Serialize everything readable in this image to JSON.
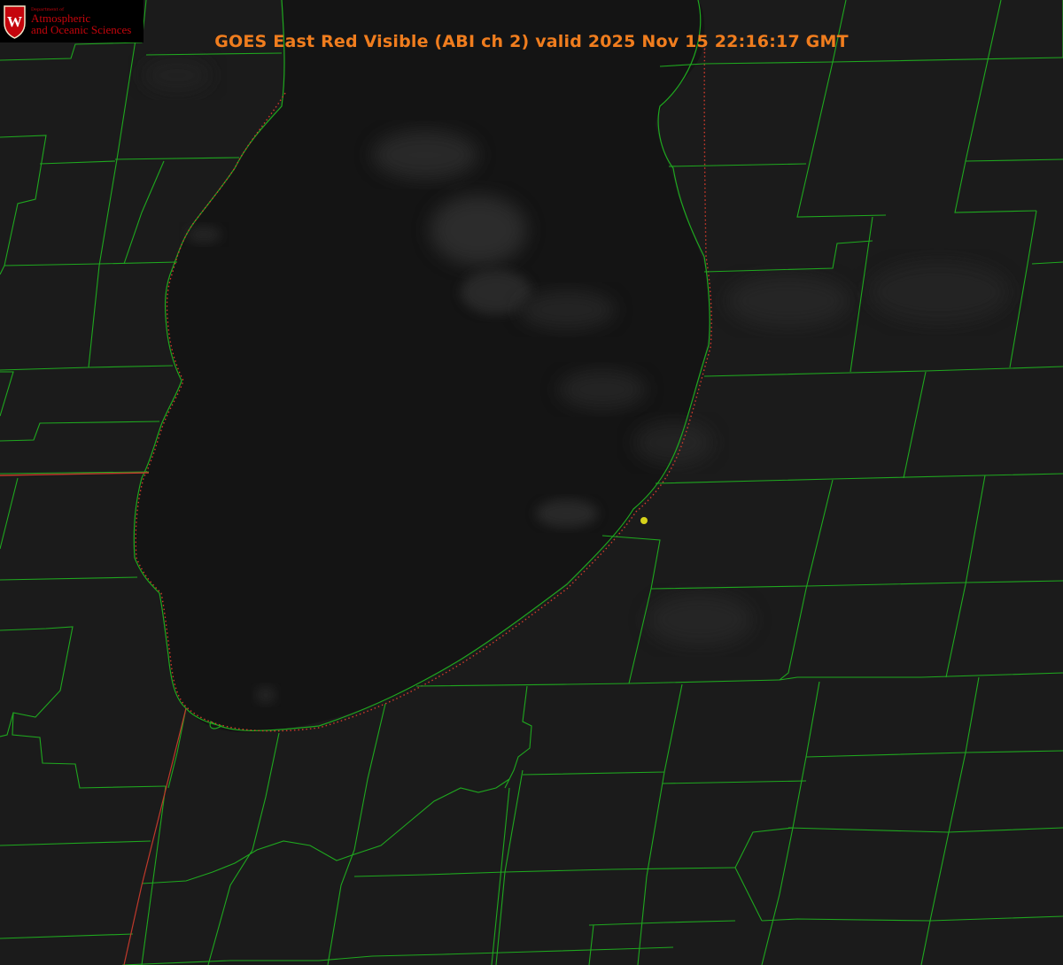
{
  "title": "GOES East Red Visible (ABI ch 2) valid 2025 Nov 15 22:16:17 GMT",
  "logo": {
    "seal_letter": "W",
    "dept_label": "Department of",
    "line1": "Atmospheric",
    "line2": "and Oceanic Sciences"
  },
  "colors": {
    "background": "#1b1b1b",
    "lake": "#141414",
    "county_lines": "#1fa81f",
    "state_line": "#c0392b",
    "shoreline_dots": "#d33b2c",
    "title": "#f07d1e",
    "site_marker": "#d6d21a"
  },
  "map": {
    "icons": [
      "uw-seal-icon",
      "site-marker-icon"
    ]
  }
}
